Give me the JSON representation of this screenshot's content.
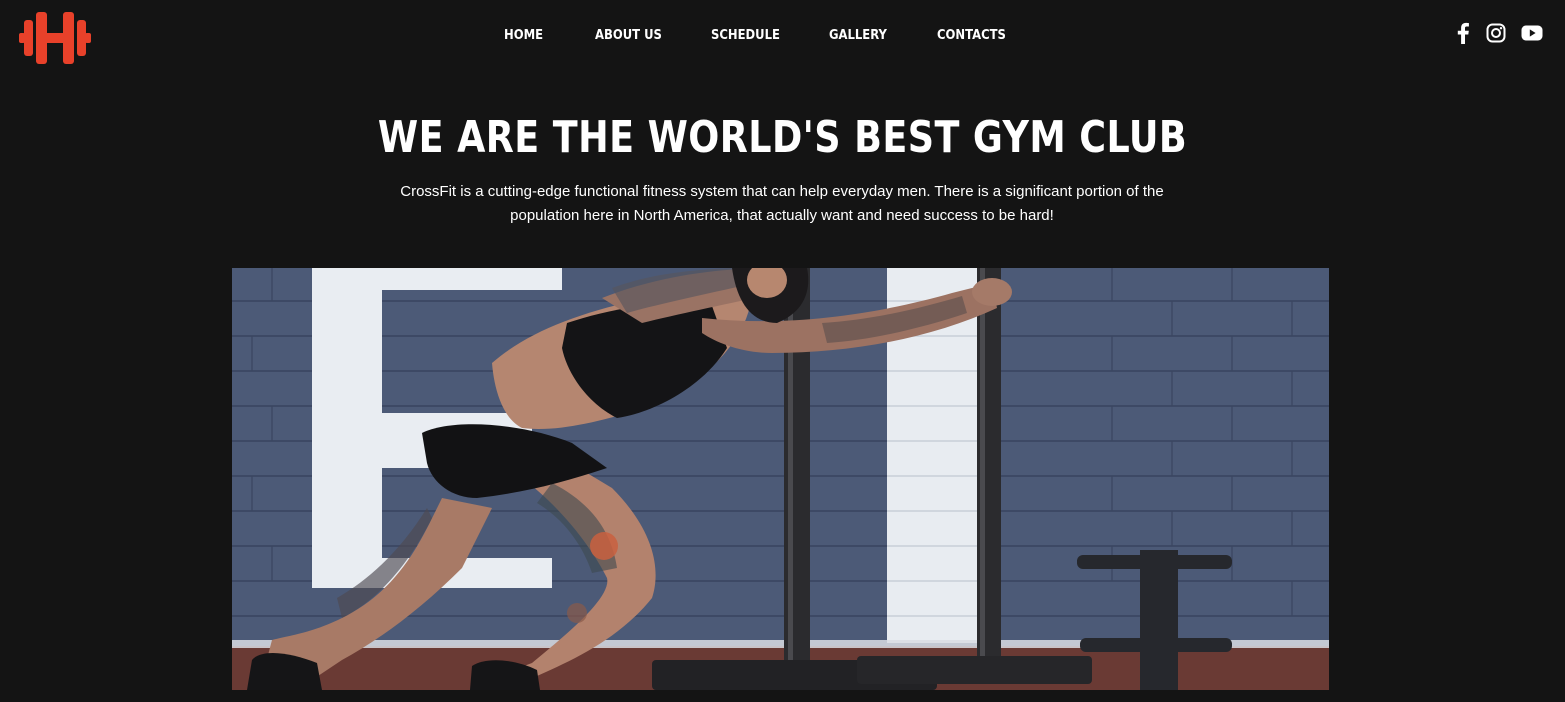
{
  "header": {
    "logo_icon": "dumbbell-logo-icon",
    "brand_color": "#e8412a",
    "nav": [
      {
        "label": "HOME"
      },
      {
        "label": "ABOUT US"
      },
      {
        "label": "SCHEDULE"
      },
      {
        "label": "GALLERY"
      },
      {
        "label": "CONTACTS"
      }
    ],
    "social": [
      {
        "icon": "facebook-icon"
      },
      {
        "icon": "instagram-icon"
      },
      {
        "icon": "youtube-icon"
      }
    ]
  },
  "hero": {
    "title": "WE ARE THE WORLD'S BEST GYM CLUB",
    "description": "CrossFit is a cutting-edge functional fitness system that can help everyday men. There is a significant portion of the population here in North America, that actually want and need success to be hard!",
    "image_icon": "athlete-pushing-sled-photo"
  },
  "colors": {
    "background": "#141414",
    "text": "#ffffff",
    "accent": "#e8412a"
  }
}
